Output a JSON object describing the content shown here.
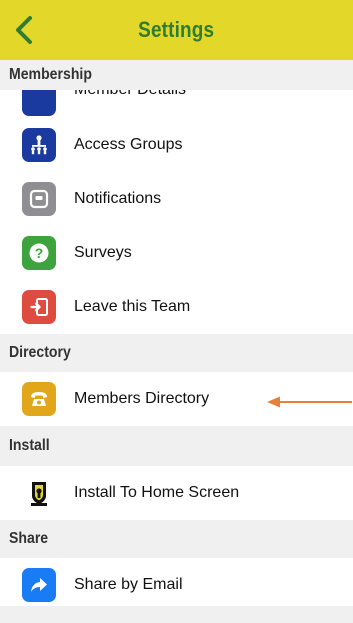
{
  "header": {
    "title": "Settings",
    "back_icon": "chevron-left-icon",
    "background": "#e3d72a",
    "title_color": "#2e7d32"
  },
  "sections": {
    "membership": "Membership",
    "directory": "Directory",
    "install": "Install",
    "share": "Share"
  },
  "membership_items": [
    {
      "label": "Member Details",
      "icon": "member-details-icon",
      "color": "#1b3aa0"
    },
    {
      "label": "Access Groups",
      "icon": "access-groups-icon",
      "color": "#1b3aa0"
    },
    {
      "label": "Notifications",
      "icon": "notifications-icon",
      "color": "#8e8e93"
    },
    {
      "label": "Surveys",
      "icon": "question-mark-icon",
      "color": "#3da33d"
    },
    {
      "label": "Leave this Team",
      "icon": "exit-icon",
      "color": "#e04b3f"
    }
  ],
  "directory_items": [
    {
      "label": "Members Directory",
      "icon": "phone-icon",
      "color": "#e2a61a"
    }
  ],
  "install_items": [
    {
      "label": "Install To Home Screen",
      "icon": "app-logo-icon"
    }
  ],
  "share_items": [
    {
      "label": "Share by Email",
      "icon": "share-arrow-icon",
      "color": "#1a7cf5"
    }
  ],
  "annotation": {
    "icon": "left-arrow-icon",
    "color": "#e8803a"
  }
}
